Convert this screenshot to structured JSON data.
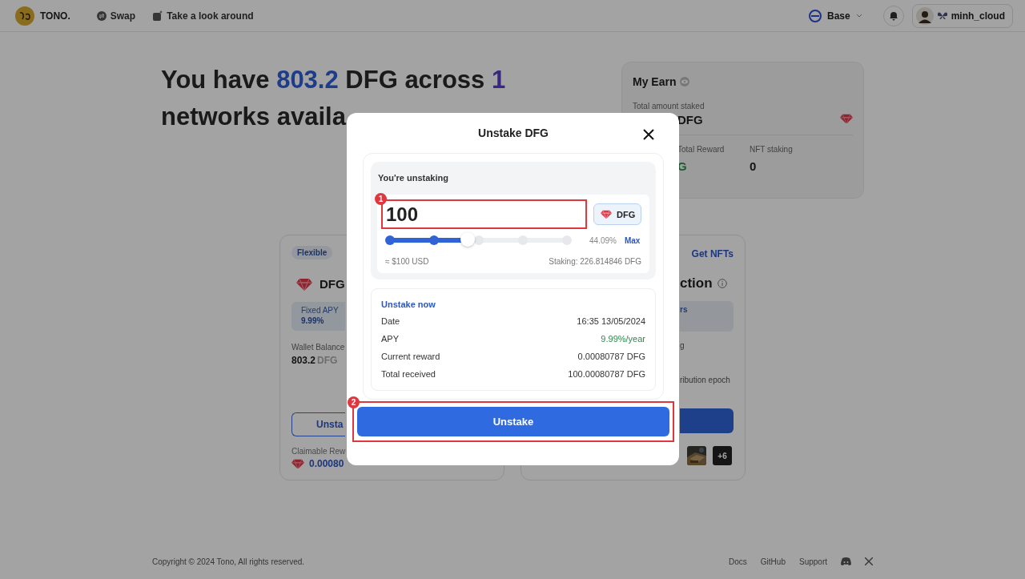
{
  "header": {
    "brand": "TONO.",
    "nav": [
      {
        "label": "Swap",
        "kind": "swap"
      },
      {
        "label": "Take a look around",
        "kind": "tour"
      }
    ],
    "network": "Base",
    "username": "minh_cloud"
  },
  "heading": {
    "line_1": [
      {
        "text": "You have ",
        "kind": "plain"
      },
      {
        "text": "803.2",
        "kind": "amount"
      },
      {
        "text": " DFG across ",
        "kind": "plain"
      },
      {
        "text": "1",
        "kind": "count"
      }
    ],
    "line_2": "networks availa"
  },
  "earn_card": {
    "title": "My Earn",
    "total_staked_label": "Total amount staked",
    "total_staked_value": "DFG",
    "total_reward_label": "Total Reward",
    "total_reward_value": "G",
    "nft_staking_label": "NFT staking",
    "nft_staking_value": "0"
  },
  "flexible_card": {
    "badge": "Flexible",
    "token": "DFG",
    "apy_label": "Fixed APY",
    "apy_value": "9.99%",
    "wallet_label": "Wallet Balance",
    "wallet_amount": "803.2",
    "wallet_unit": "DFG",
    "unstake_button": "Unsta",
    "claimable_label": "Claimable Rew",
    "claimable_value": "0.00080"
  },
  "nft_card": {
    "link": "Get NFTs",
    "title": "ction",
    "info_text": "rs",
    "line_1": "g",
    "line_2": "ribution epoch",
    "more_count": "+6"
  },
  "modal": {
    "title": "Unstake DFG",
    "section_label": "You're unstaking",
    "amount": "100",
    "amount_marker": "1",
    "token": "DFG",
    "level": 0.4409,
    "percent": "44.09%",
    "max": "Max",
    "usd": "≈ $100 USD",
    "staking": "Staking: 226.814846 DFG",
    "details_title": "Unstake now",
    "details": [
      {
        "label": "Date",
        "value": "16:35 13/05/2024",
        "kind": "plain"
      },
      {
        "label": "APY",
        "value": "9.99%/year",
        "kind": "positive"
      },
      {
        "label": "Current reward",
        "value": "0.00080787 DFG",
        "kind": "plain"
      },
      {
        "label": "Total received",
        "value": "100.00080787 DFG",
        "kind": "plain"
      }
    ],
    "submit": "Unstake",
    "submit_marker": "2"
  },
  "footer": {
    "copyright": "Copyright © 2024 Tono, All rights reserved.",
    "links": [
      "Docs",
      "GitHub",
      "Support"
    ]
  }
}
